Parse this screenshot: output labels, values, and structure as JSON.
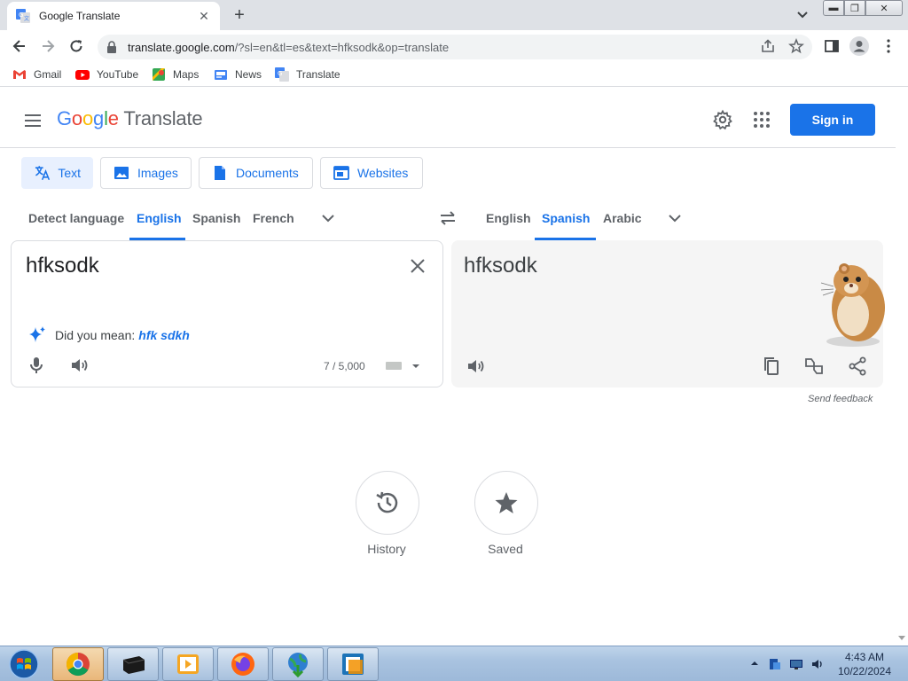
{
  "browser": {
    "tab_title": "Google Translate",
    "url_host": "translate.google.com",
    "url_rest": "/?sl=en&tl=es&text=hfksodk&op=translate",
    "bookmarks": [
      "Gmail",
      "YouTube",
      "Maps",
      "News",
      "Translate"
    ]
  },
  "header": {
    "logo_google": "Google",
    "logo_translate": "Translate",
    "signin_label": "Sign in"
  },
  "modes": [
    "Text",
    "Images",
    "Documents",
    "Websites"
  ],
  "source_langs": [
    "Detect language",
    "English",
    "Spanish",
    "French"
  ],
  "source_selected": "English",
  "target_langs": [
    "English",
    "Spanish",
    "Arabic"
  ],
  "target_selected": "Spanish",
  "source": {
    "text": "hfksodk",
    "did_you_mean_label": "Did you mean:",
    "suggestion": "hfk sdkh",
    "char_count": "7 / 5,000"
  },
  "target": {
    "text": "hfksodk",
    "feedback": "Send feedback"
  },
  "bottom": {
    "history_label": "History",
    "saved_label": "Saved"
  },
  "taskbar": {
    "time": "4:43 AM",
    "date": "10/22/2024"
  },
  "colors": {
    "accent": "#1a73e8",
    "google_blue": "#4285f4",
    "google_red": "#ea4335",
    "google_yellow": "#fbbc04",
    "google_green": "#34a853"
  }
}
